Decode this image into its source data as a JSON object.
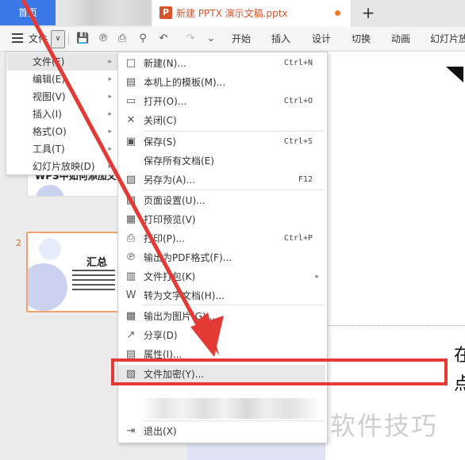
{
  "tabs": {
    "home": "首页",
    "document": "新建 PPTX 演示文稿.pptx",
    "doc_icon_letter": "P",
    "new_tab": "+"
  },
  "ribbon": {
    "file": "文件",
    "tabs": [
      "开始",
      "插入",
      "设计",
      "切换",
      "动画",
      "幻灯片放"
    ]
  },
  "left_menu": {
    "items": [
      {
        "label": "文件(F)",
        "active": true
      },
      {
        "label": "编辑(E)",
        "active": false
      },
      {
        "label": "视图(V)",
        "active": false
      },
      {
        "label": "插入(I)",
        "active": false
      },
      {
        "label": "格式(O)",
        "active": false
      },
      {
        "label": "工具(T)",
        "active": false
      },
      {
        "label": "幻灯片放映(D)",
        "active": false
      }
    ]
  },
  "file_menu": {
    "items": [
      {
        "label": "新建(N)...",
        "shortcut": "Ctrl+N",
        "icon": "new-file-icon"
      },
      {
        "label": "本机上的模板(M)...",
        "shortcut": "",
        "icon": "template-icon"
      },
      {
        "label": "打开(O)...",
        "shortcut": "Ctrl+O",
        "icon": "open-folder-icon"
      },
      {
        "label": "关闭(C)",
        "shortcut": "",
        "icon": "close-file-icon"
      },
      {
        "label": "保存(S)",
        "shortcut": "Ctrl+S",
        "icon": "save-icon"
      },
      {
        "label": "保存所有文档(E)",
        "shortcut": "",
        "icon": ""
      },
      {
        "label": "另存为(A)...",
        "shortcut": "F12",
        "icon": "save-as-icon"
      },
      {
        "label": "页面设置(U)...",
        "shortcut": "",
        "icon": "page-setup-icon"
      },
      {
        "label": "打印预览(V)",
        "shortcut": "",
        "icon": "print-preview-icon"
      },
      {
        "label": "打印(P)...",
        "shortcut": "Ctrl+P",
        "icon": "print-icon"
      },
      {
        "label": "输出为PDF格式(F)...",
        "shortcut": "",
        "icon": "export-pdf-icon"
      },
      {
        "label": "文件打包(K)",
        "shortcut": "",
        "icon": "package-icon"
      },
      {
        "label": "转为文字文档(H)...",
        "shortcut": "",
        "icon": "to-word-icon"
      },
      {
        "label": "输出为图片(G)...",
        "shortcut": "",
        "icon": "export-image-icon"
      },
      {
        "label": "分享(D)",
        "shortcut": "",
        "icon": "share-icon"
      },
      {
        "label": "属性(I)...",
        "shortcut": "",
        "icon": "properties-icon"
      },
      {
        "label": "文件加密(Y)...",
        "shortcut": "",
        "icon": "encrypt-icon"
      },
      {
        "label": "退出(X)",
        "shortcut": "",
        "icon": "exit-icon"
      }
    ]
  },
  "slides": {
    "slide1_title": "WPS中如何添加文",
    "slide2_number": "2",
    "slide2_title": "汇总"
  },
  "canvas": {
    "char1": "在",
    "char2": "点"
  },
  "watermark": "软件技巧",
  "colors": {
    "accent": "#3978e6",
    "doc_orange": "#d9532b",
    "highlight_red": "#e53935"
  }
}
